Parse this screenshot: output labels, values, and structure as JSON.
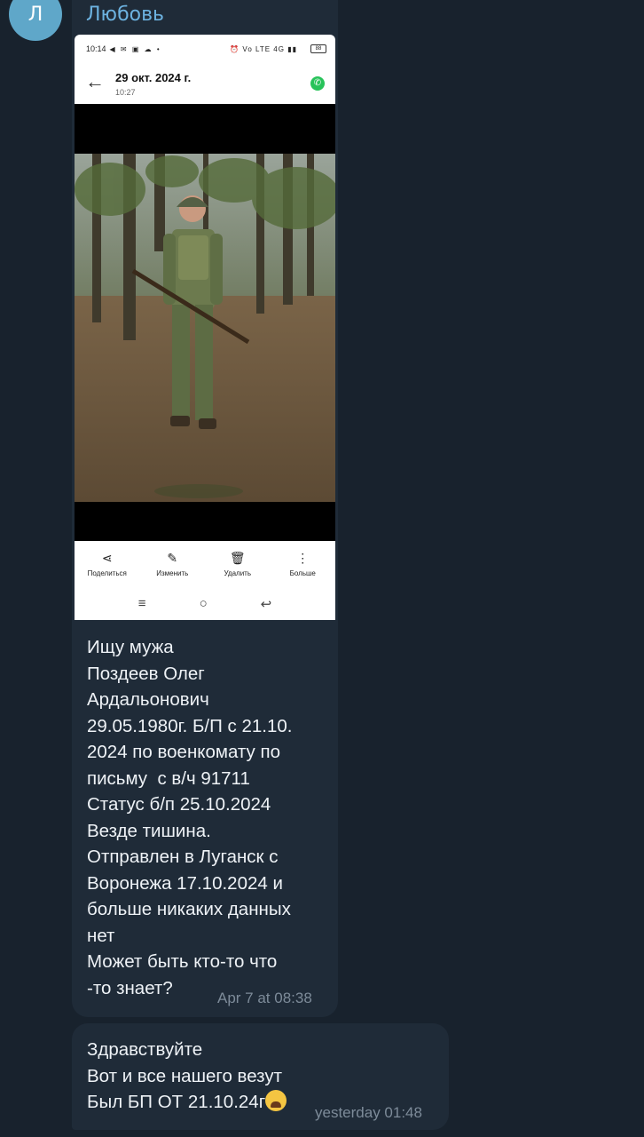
{
  "sender": {
    "initial": "Л",
    "name": "Любовь"
  },
  "screenshot": {
    "status_time": "10:14",
    "status_left_icons": "◀ ✉ ▣ ☁ •",
    "status_right_icons": "⏰ Vo LTE 4G ▮▮",
    "battery": "88",
    "header_date": "29 окт. 2024 г.",
    "header_time": "10:27",
    "toolbar": [
      {
        "icon": "share-icon",
        "glyph": "⋖",
        "label": "Поделиться"
      },
      {
        "icon": "edit-icon",
        "glyph": "✎",
        "label": "Изменить"
      },
      {
        "icon": "trash-icon",
        "glyph": "🗑",
        "label": "Удалить"
      },
      {
        "icon": "more-icon",
        "glyph": "⋮",
        "label": "Больше"
      }
    ],
    "nav": [
      "≡",
      "○",
      "↩"
    ]
  },
  "message1": {
    "text": "Ищу мужа\nПоздеев Олег\nАрдальонович\n29.05.1980г. Б/П с 21.10.\n2024 по военкомату по\nписьму  с в/ч 91711\nСтатус б/п 25.10.2024\nВезде тишина.\nОтправлен в Луганск с\nВоронежа 17.10.2024 и\nбольше никаких данных\nнет\nМожет быть кто-то что\n-то знает?",
    "time": "Apr 7 at 08:38"
  },
  "message2": {
    "text": "Здравствуйте\nВот и все нашего везут\nБыл БП ОТ 21.10.24г",
    "time": "yesterday 01:48"
  }
}
